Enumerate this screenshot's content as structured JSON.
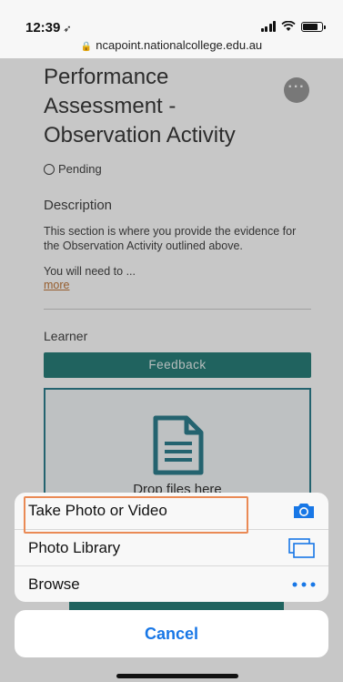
{
  "status_bar": {
    "time": "12:39",
    "location_icon": "location-arrow-icon",
    "url": "ncapoint.nationalcollege.edu.au"
  },
  "page": {
    "title": "Performance Assessment - Observation Activity",
    "status": "Pending",
    "description_heading": "Description",
    "description_text": "This section is where you provide the evidence for the Observation Activity outlined above.",
    "description_more_text": "You will need to ...",
    "more_link": "more",
    "learner_heading": "Learner",
    "feedback_button": "Feedback",
    "drop_text": "Drop files here"
  },
  "action_sheet": {
    "items": [
      {
        "label": "Take Photo or Video",
        "icon": "camera-icon"
      },
      {
        "label": "Photo Library",
        "icon": "photo-library-icon"
      },
      {
        "label": "Browse",
        "icon": "ellipsis-icon"
      }
    ],
    "cancel_label": "Cancel"
  },
  "colors": {
    "accent": "#1877e6",
    "teal": "#2a7f7a",
    "highlight": "#ea8a55",
    "link": "#c0783a"
  }
}
